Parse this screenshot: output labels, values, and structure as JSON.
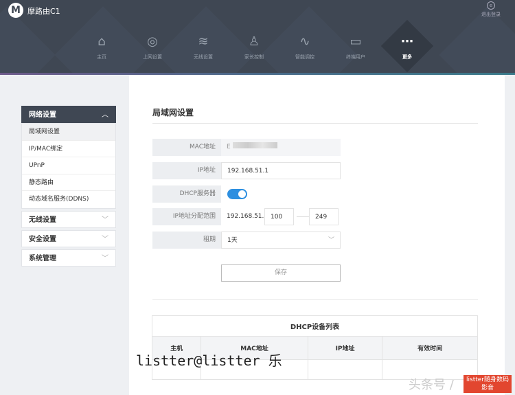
{
  "header": {
    "logo": "M",
    "brand": "摩路由C1",
    "logout_label": "退出登录"
  },
  "nav": [
    {
      "label": "主页",
      "icon": "⌂"
    },
    {
      "label": "上网设置",
      "icon": "◎"
    },
    {
      "label": "无线设置",
      "icon": "≋"
    },
    {
      "label": "家长控制",
      "icon": "♙"
    },
    {
      "label": "智能调控",
      "icon": "∿"
    },
    {
      "label": "终端用户",
      "icon": "▭"
    },
    {
      "label": "更多",
      "icon": "⋯"
    }
  ],
  "sidebar": {
    "open_group": "网络设置",
    "items": [
      "局域网设置",
      "IP/MAC绑定",
      "UPnP",
      "静态路由",
      "动态域名服务(DDNS)"
    ],
    "groups": [
      "无线设置",
      "安全设置",
      "系统管理"
    ]
  },
  "form": {
    "title": "局域网设置",
    "mac_label": "MAC地址",
    "mac_value": "E",
    "ip_label": "IP地址",
    "ip_value": "192.168.51.1",
    "dhcp_label": "DHCP服务器",
    "range_label": "IP地址分配范围",
    "range_prefix": "192.168.51.",
    "range_start": "100",
    "range_end": "249",
    "lease_label": "租期",
    "lease_value": "1天",
    "save_label": "保存"
  },
  "dhcp_table": {
    "title": "DHCP设备列表",
    "columns": [
      "主机",
      "MAC地址",
      "IP地址",
      "有效时间"
    ]
  },
  "watermarks": {
    "w1": "listter@listter 乐",
    "w2": "头条号 /",
    "w3": "listter随身数码影音"
  },
  "colors": {
    "header": "#3f4753",
    "toggle": "#2d8fe0"
  }
}
